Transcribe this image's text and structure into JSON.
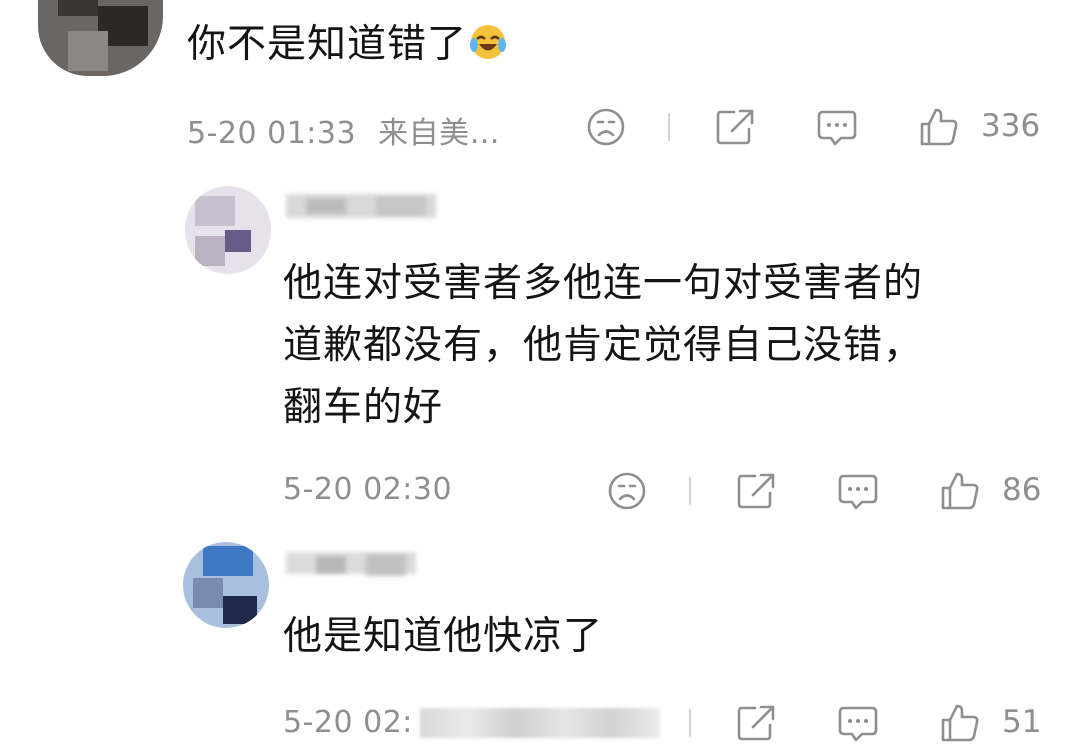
{
  "comments": [
    {
      "text": "你不是知道错了",
      "emoji": "laughing-crying-emoji",
      "time": "5-20 01:33",
      "location": "来自美…",
      "likes": "336"
    },
    {
      "text_lines": [
        "他连对受害者多他连一句对受害者的",
        "道歉都没有，他肯定觉得自己没错，",
        "翻车的好"
      ],
      "time": "5-20 02:30",
      "likes": "86"
    },
    {
      "text": "他是知道他快凉了",
      "time": "5-20 02:",
      "likes": "51"
    }
  ],
  "icons": {
    "dislike": "frown-face-icon",
    "share": "share-icon",
    "reply": "comment-icon",
    "like": "thumbs-up-icon"
  },
  "colors": {
    "text": "#141414",
    "meta": "#8f8f8f",
    "background": "#ffffff"
  }
}
